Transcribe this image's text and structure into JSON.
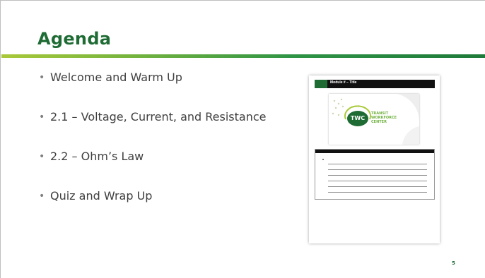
{
  "slide": {
    "title": "Agenda",
    "bullets": [
      "Welcome and Warm Up",
      "2.1 – Voltage, Current, and Resistance",
      "2.2 – Ohm’s Law",
      "Quiz and Wrap Up"
    ],
    "bullet_glyph": "•",
    "page_number": "5",
    "thumbnail": {
      "header_text": "Module # – Title",
      "logo_initials": "TWC",
      "logo_lines": [
        "TRANSIT",
        "WORKFORCE",
        "CENTER"
      ]
    },
    "colors": {
      "title": "#1e6b34",
      "accent_green": "#6fb13f",
      "text": "#404040"
    }
  }
}
